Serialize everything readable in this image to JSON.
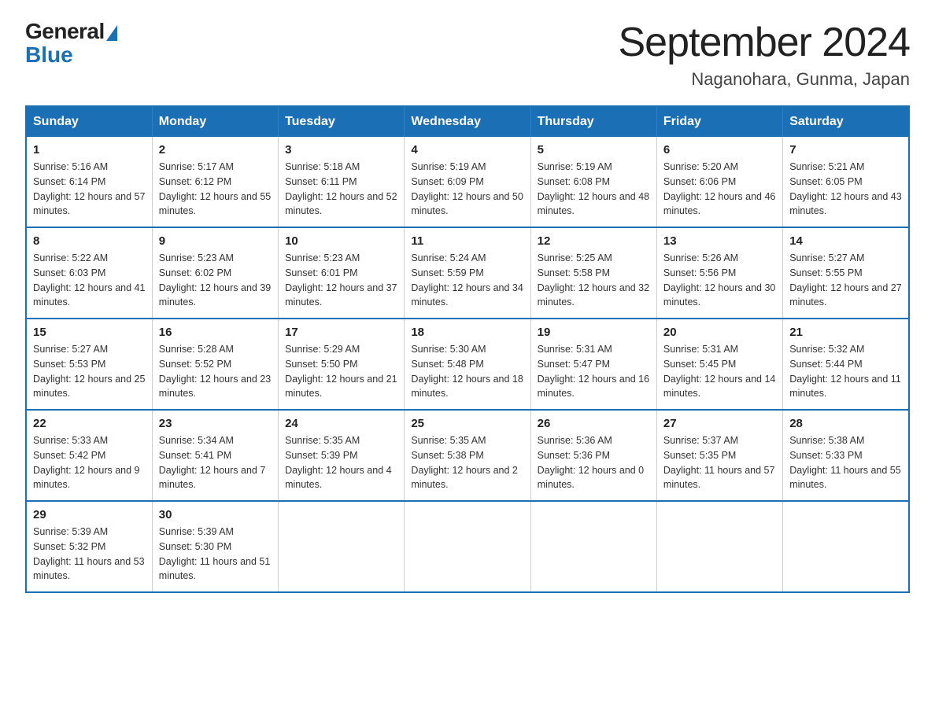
{
  "logo": {
    "general": "General",
    "blue": "Blue"
  },
  "title": "September 2024",
  "location": "Naganohara, Gunma, Japan",
  "days_of_week": [
    "Sunday",
    "Monday",
    "Tuesday",
    "Wednesday",
    "Thursday",
    "Friday",
    "Saturday"
  ],
  "weeks": [
    [
      {
        "day": "1",
        "sunrise": "5:16 AM",
        "sunset": "6:14 PM",
        "daylight": "12 hours and 57 minutes."
      },
      {
        "day": "2",
        "sunrise": "5:17 AM",
        "sunset": "6:12 PM",
        "daylight": "12 hours and 55 minutes."
      },
      {
        "day": "3",
        "sunrise": "5:18 AM",
        "sunset": "6:11 PM",
        "daylight": "12 hours and 52 minutes."
      },
      {
        "day": "4",
        "sunrise": "5:19 AM",
        "sunset": "6:09 PM",
        "daylight": "12 hours and 50 minutes."
      },
      {
        "day": "5",
        "sunrise": "5:19 AM",
        "sunset": "6:08 PM",
        "daylight": "12 hours and 48 minutes."
      },
      {
        "day": "6",
        "sunrise": "5:20 AM",
        "sunset": "6:06 PM",
        "daylight": "12 hours and 46 minutes."
      },
      {
        "day": "7",
        "sunrise": "5:21 AM",
        "sunset": "6:05 PM",
        "daylight": "12 hours and 43 minutes."
      }
    ],
    [
      {
        "day": "8",
        "sunrise": "5:22 AM",
        "sunset": "6:03 PM",
        "daylight": "12 hours and 41 minutes."
      },
      {
        "day": "9",
        "sunrise": "5:23 AM",
        "sunset": "6:02 PM",
        "daylight": "12 hours and 39 minutes."
      },
      {
        "day": "10",
        "sunrise": "5:23 AM",
        "sunset": "6:01 PM",
        "daylight": "12 hours and 37 minutes."
      },
      {
        "day": "11",
        "sunrise": "5:24 AM",
        "sunset": "5:59 PM",
        "daylight": "12 hours and 34 minutes."
      },
      {
        "day": "12",
        "sunrise": "5:25 AM",
        "sunset": "5:58 PM",
        "daylight": "12 hours and 32 minutes."
      },
      {
        "day": "13",
        "sunrise": "5:26 AM",
        "sunset": "5:56 PM",
        "daylight": "12 hours and 30 minutes."
      },
      {
        "day": "14",
        "sunrise": "5:27 AM",
        "sunset": "5:55 PM",
        "daylight": "12 hours and 27 minutes."
      }
    ],
    [
      {
        "day": "15",
        "sunrise": "5:27 AM",
        "sunset": "5:53 PM",
        "daylight": "12 hours and 25 minutes."
      },
      {
        "day": "16",
        "sunrise": "5:28 AM",
        "sunset": "5:52 PM",
        "daylight": "12 hours and 23 minutes."
      },
      {
        "day": "17",
        "sunrise": "5:29 AM",
        "sunset": "5:50 PM",
        "daylight": "12 hours and 21 minutes."
      },
      {
        "day": "18",
        "sunrise": "5:30 AM",
        "sunset": "5:48 PM",
        "daylight": "12 hours and 18 minutes."
      },
      {
        "day": "19",
        "sunrise": "5:31 AM",
        "sunset": "5:47 PM",
        "daylight": "12 hours and 16 minutes."
      },
      {
        "day": "20",
        "sunrise": "5:31 AM",
        "sunset": "5:45 PM",
        "daylight": "12 hours and 14 minutes."
      },
      {
        "day": "21",
        "sunrise": "5:32 AM",
        "sunset": "5:44 PM",
        "daylight": "12 hours and 11 minutes."
      }
    ],
    [
      {
        "day": "22",
        "sunrise": "5:33 AM",
        "sunset": "5:42 PM",
        "daylight": "12 hours and 9 minutes."
      },
      {
        "day": "23",
        "sunrise": "5:34 AM",
        "sunset": "5:41 PM",
        "daylight": "12 hours and 7 minutes."
      },
      {
        "day": "24",
        "sunrise": "5:35 AM",
        "sunset": "5:39 PM",
        "daylight": "12 hours and 4 minutes."
      },
      {
        "day": "25",
        "sunrise": "5:35 AM",
        "sunset": "5:38 PM",
        "daylight": "12 hours and 2 minutes."
      },
      {
        "day": "26",
        "sunrise": "5:36 AM",
        "sunset": "5:36 PM",
        "daylight": "12 hours and 0 minutes."
      },
      {
        "day": "27",
        "sunrise": "5:37 AM",
        "sunset": "5:35 PM",
        "daylight": "11 hours and 57 minutes."
      },
      {
        "day": "28",
        "sunrise": "5:38 AM",
        "sunset": "5:33 PM",
        "daylight": "11 hours and 55 minutes."
      }
    ],
    [
      {
        "day": "29",
        "sunrise": "5:39 AM",
        "sunset": "5:32 PM",
        "daylight": "11 hours and 53 minutes."
      },
      {
        "day": "30",
        "sunrise": "5:39 AM",
        "sunset": "5:30 PM",
        "daylight": "11 hours and 51 minutes."
      },
      null,
      null,
      null,
      null,
      null
    ]
  ]
}
